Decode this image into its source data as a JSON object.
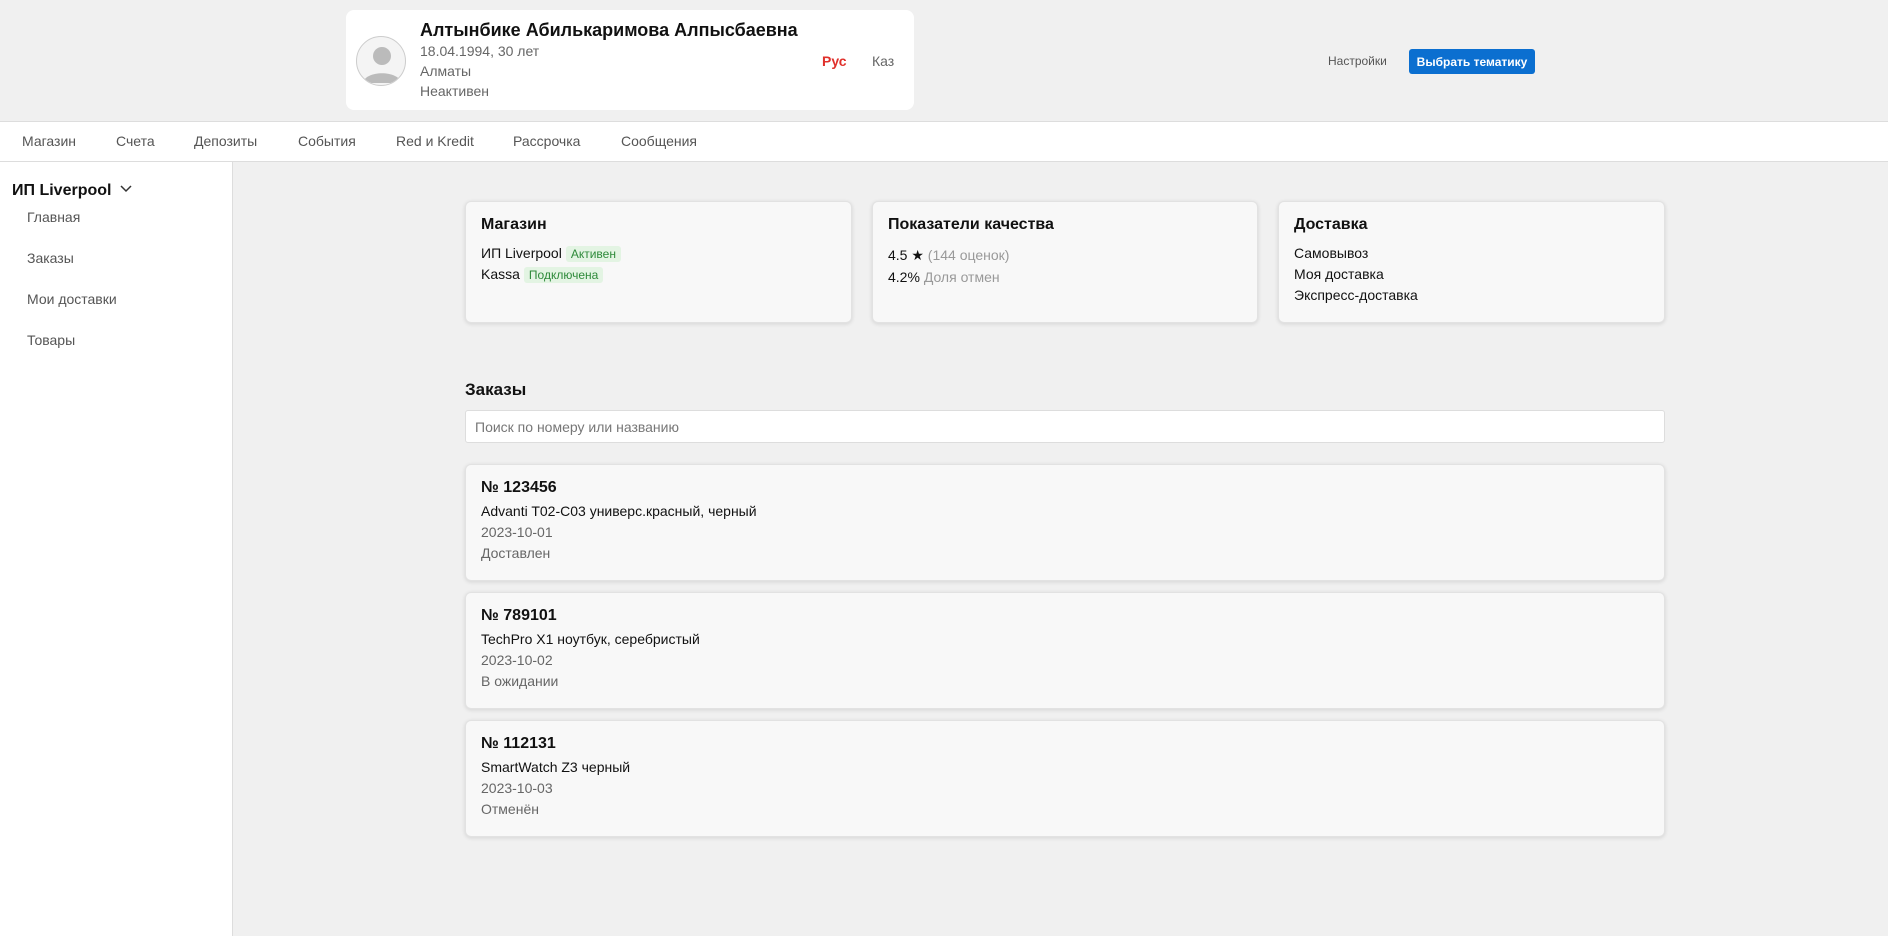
{
  "profile": {
    "name": "Алтынбике Абилькаримова Алпысбаевна",
    "dob_age": "18.04.1994, 30 лет",
    "city": "Алматы",
    "status": "Неактивен"
  },
  "lang": {
    "ru": "Рус",
    "kz": "Каз",
    "active_color": "#e0302b"
  },
  "header": {
    "settings": "Настройки",
    "theme_button": "Выбрать тематику",
    "accent": "#0b6fd0"
  },
  "nav": [
    "Магазин",
    "Счета",
    "Депозиты",
    "События",
    "Red и Kredit",
    "Рассрочка",
    "Сообщения"
  ],
  "sidebar": {
    "store": "ИП Liverpool",
    "items": [
      "Главная",
      "Заказы",
      "Мои доставки",
      "Товары"
    ]
  },
  "cards": {
    "shop": {
      "title": "Магазин",
      "line1": "ИП Liverpool",
      "line1_badge": "Активен",
      "line2": "Kassa",
      "line2_badge": "Подключена"
    },
    "quality": {
      "title": "Показатели качества",
      "rating": "4.5 ★",
      "rating_note": "(144 оценок)",
      "cancel": "4.2%",
      "cancel_note": "Доля отмен"
    },
    "delivery": {
      "title": "Доставка",
      "items": [
        "Самовывоз",
        "Моя доставка",
        "Экспресс-доставка"
      ]
    }
  },
  "orders": {
    "title": "Заказы",
    "search_placeholder": "Поиск по номеру или названию",
    "list": [
      {
        "no": "№ 123456",
        "name": "Advanti T02-C03 универс.красный, черный",
        "date": "2023-10-01",
        "status": "Доставлен"
      },
      {
        "no": "№ 789101",
        "name": "TechPro X1 ноутбук, серебристый",
        "date": "2023-10-02",
        "status": "В ожидании"
      },
      {
        "no": "№ 112131",
        "name": "SmartWatch Z3 черный",
        "date": "2023-10-03",
        "status": "Отменён"
      }
    ]
  }
}
